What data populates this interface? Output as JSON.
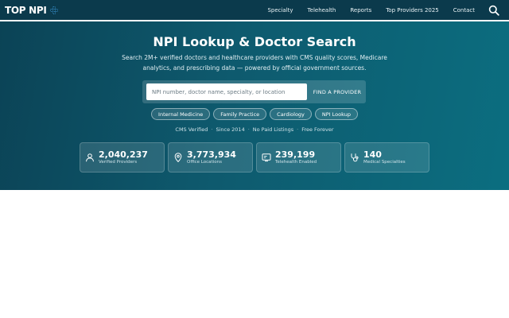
{
  "header": {
    "logo_text": "TOP NPI",
    "nav": [
      "Specialty",
      "Telehealth",
      "Reports",
      "Top Providers 2025",
      "Contact"
    ],
    "search_icon": "search-icon"
  },
  "hero": {
    "title": "NPI Lookup & Doctor Search",
    "subtitle": "Search 2M+ verified doctors and healthcare providers with CMS quality scores, Medicare analytics, and prescribing data — powered by official government sources.",
    "search": {
      "placeholder": "NPI number, doctor name, specialty, or location",
      "value": "",
      "button_label": "FIND A PROVIDER"
    },
    "chips": [
      "Internal Medicine",
      "Family Practice",
      "Cardiology",
      "NPI Lookup"
    ],
    "trust": [
      "CMS Verified",
      "Since 2014",
      "No Paid Listings",
      "Free Forever"
    ],
    "stats": [
      {
        "value": "2,040,237",
        "label": "Verified Providers",
        "icon": "user-icon"
      },
      {
        "value": "3,773,934",
        "label": "Office Locations",
        "icon": "location-pin-icon"
      },
      {
        "value": "239,199",
        "label": "Telehealth Enabled",
        "icon": "video-screen-icon"
      },
      {
        "value": "140",
        "label": "Medical Specialties",
        "icon": "stethoscope-icon"
      }
    ]
  },
  "colors": {
    "header_bg": "#0b3a4c",
    "hero_gradient_start": "#0b4356",
    "hero_gradient_end": "#0b6e80",
    "logo_plus": "#2f7fb3"
  }
}
